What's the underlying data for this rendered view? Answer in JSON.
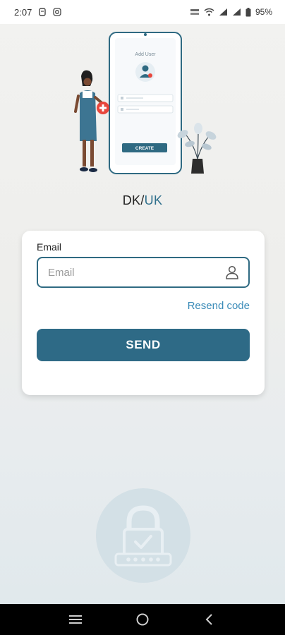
{
  "status_bar": {
    "time": "2:07",
    "battery": "95%",
    "icons": [
      "notification-icon",
      "instagram-icon",
      "data-speed-icon",
      "wifi-icon",
      "signal-icon",
      "signal-icon",
      "battery-icon"
    ]
  },
  "hero": {
    "screen_title": "Add User",
    "create_label": "CREATE"
  },
  "brand": {
    "dk": "DK",
    "sep": "/",
    "uk": "UK"
  },
  "form": {
    "email_label": "Email",
    "email_placeholder": "Email",
    "email_value": "",
    "resend_label": "Resend code",
    "send_label": "SEND"
  },
  "nav": {
    "icons": [
      "menu-icon",
      "home-icon",
      "back-icon"
    ]
  },
  "colors": {
    "primary": "#2e6a86",
    "link": "#3a8bb8",
    "accent_red": "#e8463c"
  }
}
